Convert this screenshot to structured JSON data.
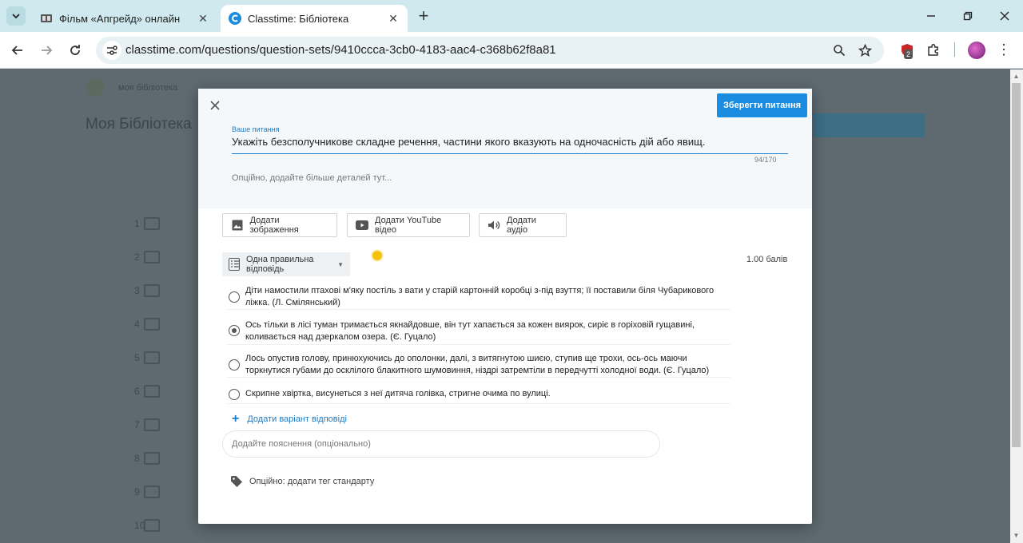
{
  "browser": {
    "tabs": [
      {
        "title": "Фільм «Апгрейд» онлайн",
        "active": false
      },
      {
        "title": "Classtime: Бібліотека",
        "active": true
      }
    ],
    "url": "classtime.com/questions/question-sets/9410ccca-3cb0-4183-aac4-c368b62f8a81",
    "extension_badge": "2"
  },
  "background_page": {
    "title": "Моя Бібліотека",
    "nav_label": "моя бібліотека",
    "row_numbers": [
      "1",
      "2",
      "3",
      "4",
      "5",
      "6",
      "7",
      "8",
      "9",
      "10"
    ]
  },
  "modal": {
    "save_label": "Зберегти питання",
    "question_label": "Ваше питання",
    "question_text": "Укажіть безсполучникове складне речення, частини якого вказують на  одночасність дій або явищ.",
    "counter": "94/170",
    "details_placeholder": "Опційно, додайте більше деталей тут...",
    "media_buttons": {
      "image": "Додати зображення",
      "youtube": "Додати YouTube відео",
      "audio": "Додати аудіо"
    },
    "question_type": "Одна правильна відповідь",
    "points": "1.00 балів",
    "answers": [
      {
        "text": "Діти намостили птахові м'яку постіль з вати у старій картонній коробці з-під взуття; її поставили біля Чубарикового ліжка. (Л. Смілянський)",
        "checked": false
      },
      {
        "text": "Ось тільки в лісі туман тримається якнайдовше, він тут хапається за кожен  виярок, сиріє в горіховій гущавині, коливається над дзеркалом озера. (Є.  Гуцало)",
        "checked": true
      },
      {
        "text": "Лось опустив голову, принюхуючись до ополонки, далі, з витягнутою  шиєю, ступив ще трохи, ось-ось маючи торкнутися губами до осклілого блакитного шумовиння, ніздрі затремтіли в передчутті холодної води. (Є.  Гуцало)",
        "checked": false
      },
      {
        "text": "Скрипне хвіртка, висунеться з неї дитяча голівка, стригне очима по вулиці.",
        "checked": false
      }
    ],
    "add_variant_label": "Додати варіант відповіді",
    "explanation_placeholder": "Додайте пояснення (опціонально)",
    "tag_label": "Опційно: додати тег стандарту"
  },
  "colors": {
    "accent": "#1b8de1",
    "browser_frame": "#cfe9ee",
    "overlay": "#5f6b71",
    "highlight_dot": "#f4c20d"
  }
}
